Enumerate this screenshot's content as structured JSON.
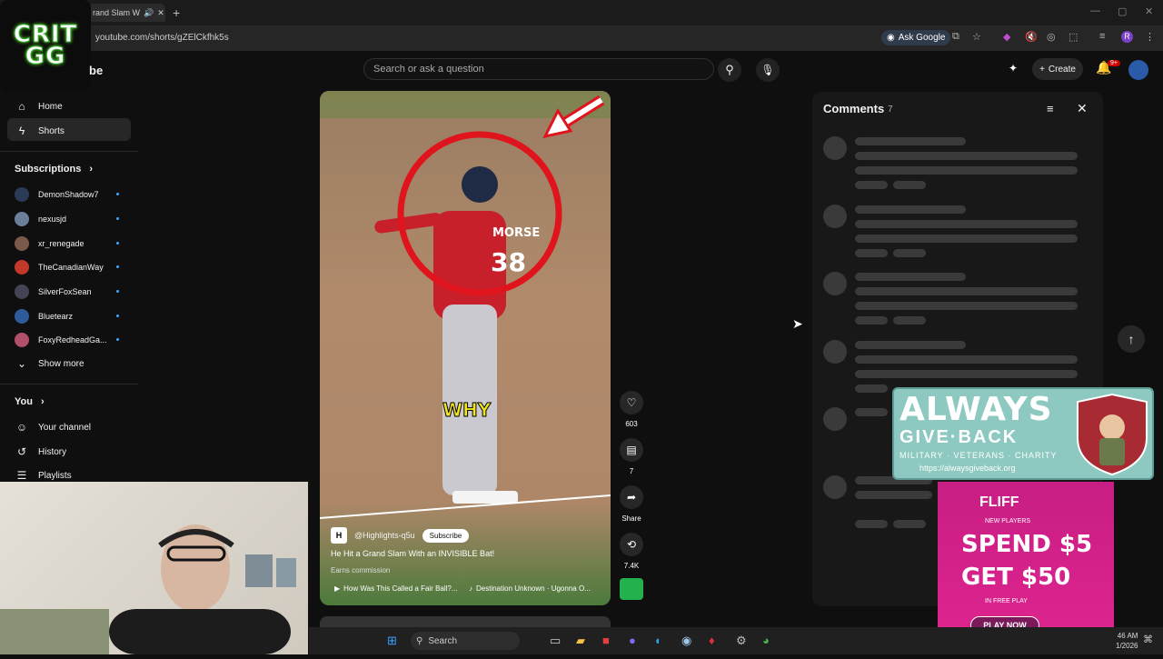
{
  "browser": {
    "tab_title": "rand Slam W",
    "url": "youtube.com/shorts/gZElCkfhk5s",
    "new_tab": "+",
    "ask_google": "Ask Google"
  },
  "channel_logo": {
    "line1": "CRIT",
    "line2": "GG"
  },
  "header": {
    "logo_label": "be",
    "search_placeholder": "Search or ask a question",
    "create_label": "Create",
    "notif_count": "9+"
  },
  "sidebar": {
    "nav": [
      {
        "label": "Home",
        "icon": "home-icon"
      },
      {
        "label": "Shorts",
        "icon": "shorts-icon"
      }
    ],
    "subscriptions_header": "Subscriptions",
    "subscriptions": [
      {
        "label": "DemonShadow7",
        "color": "#2b3a55"
      },
      {
        "label": "nexusjd",
        "color": "#6b7f9a"
      },
      {
        "label": "xr_renegade",
        "color": "#7a5a4a"
      },
      {
        "label": "TheCanadianWay",
        "color": "#c0392b"
      },
      {
        "label": "SilverFoxSean",
        "color": "#445"
      },
      {
        "label": "Bluetearz",
        "color": "#2e5c9a"
      },
      {
        "label": "FoxyRedheadGa...",
        "color": "#b0506a"
      }
    ],
    "show_more": "Show more",
    "you_header": "You",
    "you_items": [
      {
        "label": "Your channel"
      },
      {
        "label": "History"
      },
      {
        "label": "Playlists"
      }
    ]
  },
  "video": {
    "overlay_text": "WHY",
    "jersey_name": "MORSE",
    "jersey_number": "38",
    "channel": "@Highlights-q5u",
    "subscribe": "Subscribe",
    "title": "He Hit a Grand Slam With an INVISIBLE Bat!",
    "earns": "Earns commission",
    "link_title": "How Was This Called a Fair Ball?...",
    "music": "Destination Unknown · Ugonna O..."
  },
  "actions": {
    "likes": "603",
    "comments": "7",
    "share": "Share",
    "remix": "7.4K"
  },
  "comments_panel": {
    "title": "Comments",
    "count": "7"
  },
  "ad_always": {
    "line1": "ALWAYS",
    "line2": "GIVE·BACK",
    "line3": "MILITARY · VETERANS · CHARITY",
    "url": "https://alwaysgiveback.org"
  },
  "ad_fliff": {
    "brand": "FLIFF",
    "tag": "NEW PLAYERS",
    "line1": "SPEND $5",
    "line2": "GET $50",
    "sub": "IN FREE PLAY",
    "cta": "PLAY NOW"
  },
  "taskbar": {
    "search": "Search",
    "time": "46 AM",
    "date": "1/2026"
  }
}
